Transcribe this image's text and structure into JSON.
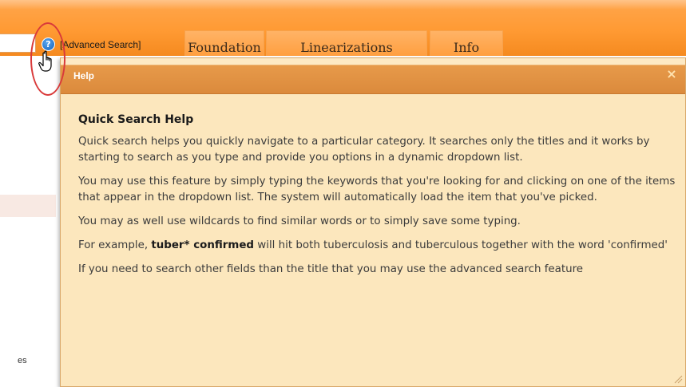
{
  "header": {
    "advanced_search_label": "[Advanced Search]",
    "help_icon_glyph": "?",
    "tabs": [
      {
        "label": "Foundation"
      },
      {
        "label": "Linearizations"
      },
      {
        "label": "Info"
      }
    ]
  },
  "left_panel": {
    "partial_text": "es"
  },
  "dialog": {
    "title": "Help",
    "close_glyph": "×",
    "heading": "Quick Search Help",
    "paragraphs": [
      "Quick search helps you quickly navigate to a particular category. It searches only the titles and it works by starting to search as you type and provide you options in a dynamic dropdown list.",
      "You may use this feature by simply typing the keywords that you're looking for and clicking on one of the items that appear in the dropdown list. The system will automatically load the item that you've picked.",
      "You may as well use wildcards to find similar words or to simply save some typing."
    ],
    "example": {
      "prefix": "For example, ",
      "bold": "tuber* confirmed",
      "suffix": " will hit both tuberculosis and tuberculous together with the word 'confirmed'"
    },
    "footer_paragraph": "If you need to search other fields than the title that you may use the advanced search feature"
  },
  "colors": {
    "header_orange": "#ff9a33",
    "dialog_bg": "#fce7bd",
    "dialog_header": "#db8a3c",
    "highlight_red": "#d93a3a",
    "help_icon_blue": "#1761b8"
  },
  "icons": {
    "help": "help-icon",
    "cursor": "hand-pointer-icon",
    "close": "close-icon",
    "resize": "resize-grip-icon"
  }
}
